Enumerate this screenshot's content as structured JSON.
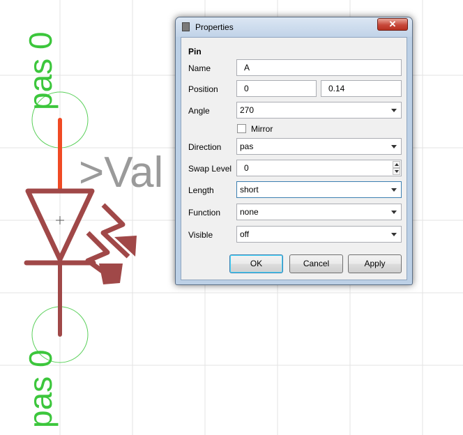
{
  "canvas": {
    "pin_top_label": "pas 0",
    "pin_bottom_label": "pas 0",
    "value_label": ">Val"
  },
  "dialog": {
    "title": "Properties",
    "close_glyph": "✕",
    "section": "Pin",
    "name": {
      "label": "Name",
      "value": "A"
    },
    "position": {
      "label": "Position",
      "x": "0",
      "y": "0.14"
    },
    "angle": {
      "label": "Angle",
      "value": "270"
    },
    "mirror": {
      "label": "Mirror",
      "checked": false
    },
    "direction": {
      "label": "Direction",
      "value": "pas"
    },
    "swap_level": {
      "label": "Swap Level",
      "value": "0"
    },
    "length": {
      "label": "Length",
      "value": "short"
    },
    "function": {
      "label": "Function",
      "value": "none"
    },
    "visible": {
      "label": "Visible",
      "value": "off"
    },
    "buttons": {
      "ok": "OK",
      "cancel": "Cancel",
      "apply": "Apply"
    }
  },
  "colors": {
    "pin_active": "#f04a24",
    "symbol": "#a04848",
    "pin_label": "#3cc63c",
    "origin_circle": "#5ad05a",
    "value_text": "#9a9a9a"
  }
}
